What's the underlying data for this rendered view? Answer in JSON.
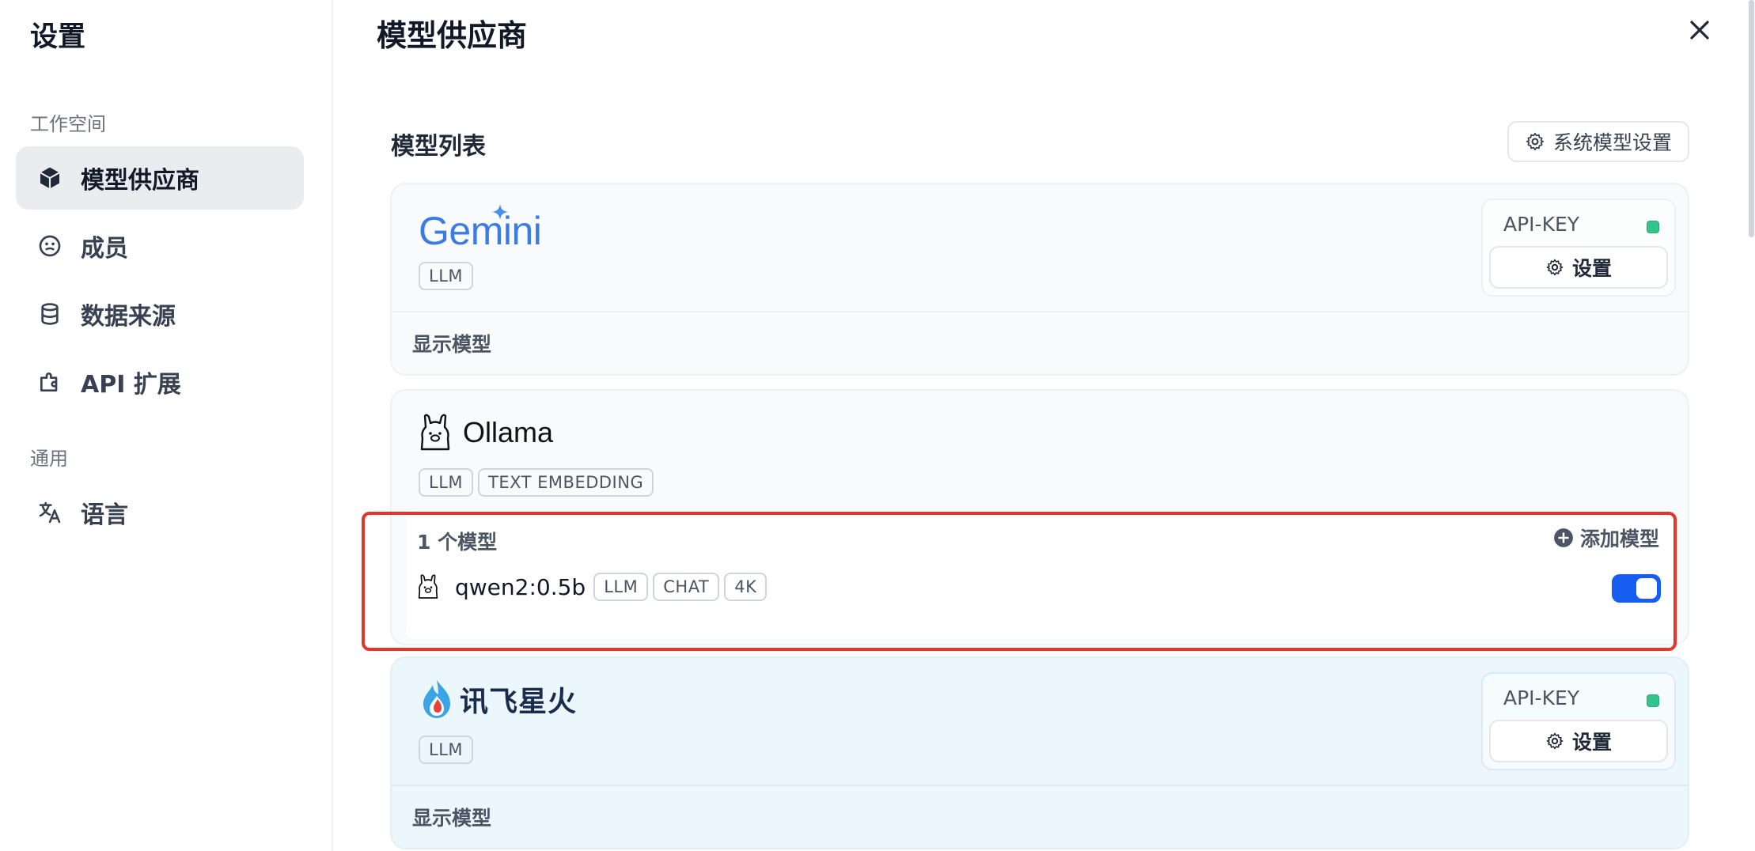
{
  "sidebar": {
    "title": "设置",
    "workspace_label": "工作空间",
    "items": [
      {
        "label": "模型供应商",
        "icon": "cube-icon"
      },
      {
        "label": "成员",
        "icon": "members-icon"
      },
      {
        "label": "数据来源",
        "icon": "database-icon"
      },
      {
        "label": "API 扩展",
        "icon": "puzzle-icon"
      }
    ],
    "general_label": "通用",
    "general_items": [
      {
        "label": "语言",
        "icon": "translate-icon"
      }
    ]
  },
  "main": {
    "title": "模型供应商",
    "list_title": "模型列表",
    "system_settings_label": "系统模型设置"
  },
  "providers": [
    {
      "name": "Gemini",
      "tags": [
        "LLM"
      ],
      "apikey_label": "API-KEY",
      "settings_label": "设置",
      "footer_label": "显示模型",
      "status_color": "#31c48d"
    },
    {
      "name": "Ollama",
      "tags": [
        "LLM",
        "TEXT EMBEDDING"
      ],
      "models_count_label": "1 个模型",
      "add_model_label": "添加模型",
      "models": [
        {
          "name": "qwen2:0.5b",
          "tags": [
            "LLM",
            "CHAT",
            "4K"
          ],
          "enabled": true
        }
      ]
    },
    {
      "name": "讯飞星火",
      "tags": [
        "LLM"
      ],
      "apikey_label": "API-KEY",
      "settings_label": "设置",
      "footer_label": "显示模型",
      "status_color": "#31c48d"
    }
  ],
  "colors": {
    "accent": "#155eef",
    "highlight": "#e5342a",
    "status_ok": "#31c48d"
  }
}
